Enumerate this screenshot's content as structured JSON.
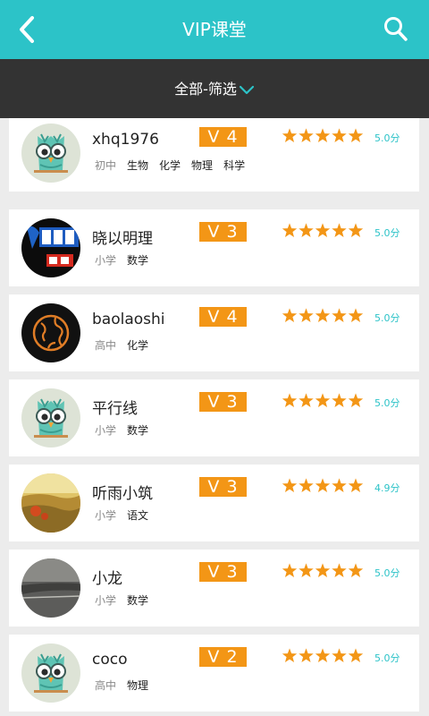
{
  "header": {
    "title": "VIP课堂",
    "back_icon": "chevron-left-icon",
    "search_icon": "search-icon"
  },
  "filter": {
    "label": "全部-筛选",
    "icon": "chevron-down-icon"
  },
  "colors": {
    "primary": "#2cc3c8",
    "filter_bg": "#333333",
    "level_badge": "#f39616",
    "star": "#f39616",
    "score": "#2cc3c8"
  },
  "teachers": [
    {
      "name": "xhq1976",
      "level": "V 4",
      "stars": 5,
      "score": "5.0分",
      "grade": "初中",
      "subjects": [
        "生物",
        "化学",
        "物理",
        "科学"
      ],
      "avatar": "owl-avatar"
    },
    {
      "name": "晓以明理",
      "level": "V 3",
      "stars": 5,
      "score": "5.0分",
      "grade": "小学",
      "subjects": [
        "数学"
      ],
      "avatar": "logo-avatar"
    },
    {
      "name": "baolaoshi",
      "level": "V 4",
      "stars": 5,
      "score": "5.0分",
      "grade": "高中",
      "subjects": [
        "化学"
      ],
      "avatar": "globe-avatar"
    },
    {
      "name": "平行线",
      "level": "V 3",
      "stars": 5,
      "score": "5.0分",
      "grade": "小学",
      "subjects": [
        "数学"
      ],
      "avatar": "owl-avatar"
    },
    {
      "name": "听雨小筑",
      "level": "V 3",
      "stars": 5,
      "score": "4.9分",
      "grade": "小学",
      "subjects": [
        "语文"
      ],
      "avatar": "field-photo-avatar"
    },
    {
      "name": "小龙",
      "level": "V 3",
      "stars": 5,
      "score": "5.0分",
      "grade": "小学",
      "subjects": [
        "数学"
      ],
      "avatar": "road-photo-avatar"
    },
    {
      "name": "coco",
      "level": "V 2",
      "stars": 5,
      "score": "5.0分",
      "grade": "高中",
      "subjects": [
        "物理"
      ],
      "avatar": "owl-avatar"
    }
  ]
}
